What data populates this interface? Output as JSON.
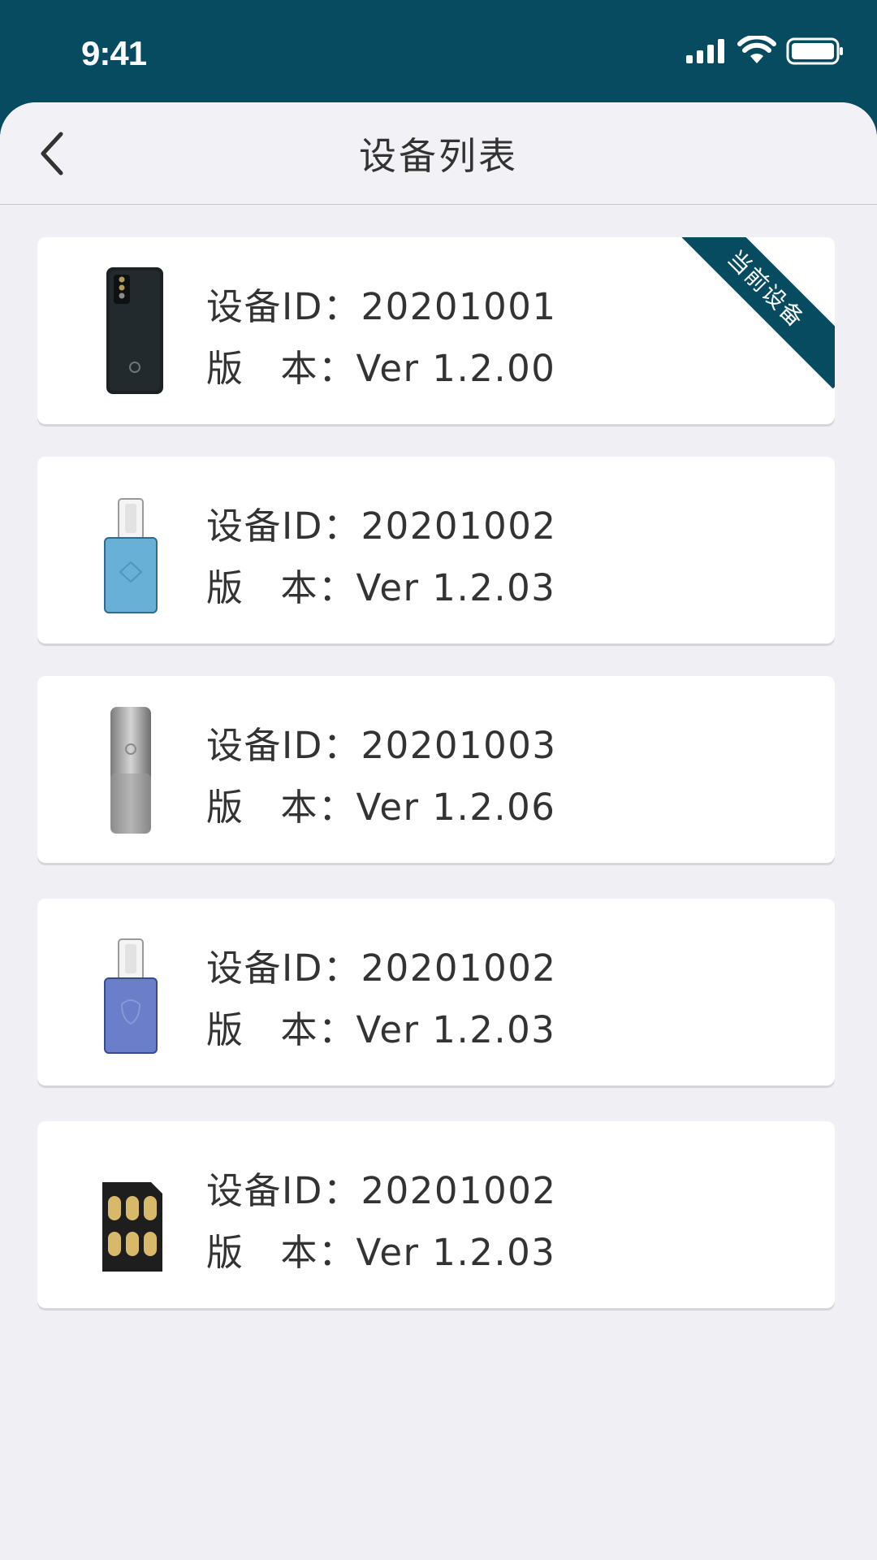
{
  "status_bar": {
    "time": "9:41",
    "icons": [
      "signal-icon",
      "wifi-icon",
      "battery-icon"
    ]
  },
  "nav": {
    "title": "设备列表",
    "back_icon": "chevron-left-icon"
  },
  "labels": {
    "id_label": "设备ID：",
    "version_label_1": "版",
    "version_label_2": "本：",
    "current_badge": "当前设备"
  },
  "devices": [
    {
      "id": "20201001",
      "version": "Ver 1.2.00",
      "kind": "phone-icon",
      "current": true
    },
    {
      "id": "20201002",
      "version": "Ver 1.2.03",
      "kind": "usb-c-key-blue-icon",
      "current": false
    },
    {
      "id": "20201003",
      "version": "Ver 1.2.06",
      "kind": "usb-key-silver-icon",
      "current": false
    },
    {
      "id": "20201002",
      "version": "Ver 1.2.03",
      "kind": "usb-c-key-purple-icon",
      "current": false
    },
    {
      "id": "20201002",
      "version": "Ver 1.2.03",
      "kind": "sim-card-icon",
      "current": false
    }
  ],
  "colors": {
    "brand": "#064b60",
    "background": "#efeff4",
    "card": "#ffffff",
    "text": "#333333"
  }
}
